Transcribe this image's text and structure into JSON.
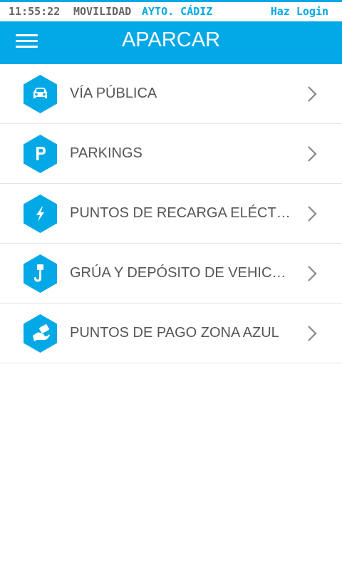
{
  "status_bar": {
    "time": "11:55:22",
    "movilidad": "MOVILIDAD",
    "ayto": "AYTO. CÁDIZ",
    "login": "Haz Login"
  },
  "header": {
    "title": "APARCAR",
    "menu_icon": "hamburger-menu-icon"
  },
  "menu": {
    "items": [
      {
        "label": "VÍA PÚBLICA",
        "icon": "car-icon"
      },
      {
        "label": "PARKINGS",
        "icon": "parking-icon"
      },
      {
        "label": "PUNTOS DE RECARGA ELÉCTRICA",
        "icon": "lightning-icon"
      },
      {
        "label": "GRÚA Y DEPÓSITO DE VEHICULOS",
        "icon": "tow-hook-icon"
      },
      {
        "label": "PUNTOS DE PAGO ZONA AZUL",
        "icon": "payment-icon"
      }
    ],
    "arrow_icon": "chevron-right-icon"
  },
  "colors": {
    "primary": "#03a9e6",
    "text": "#555555",
    "status_text": "#666666",
    "divider": "#e6e6e6",
    "chevron": "#888888"
  }
}
